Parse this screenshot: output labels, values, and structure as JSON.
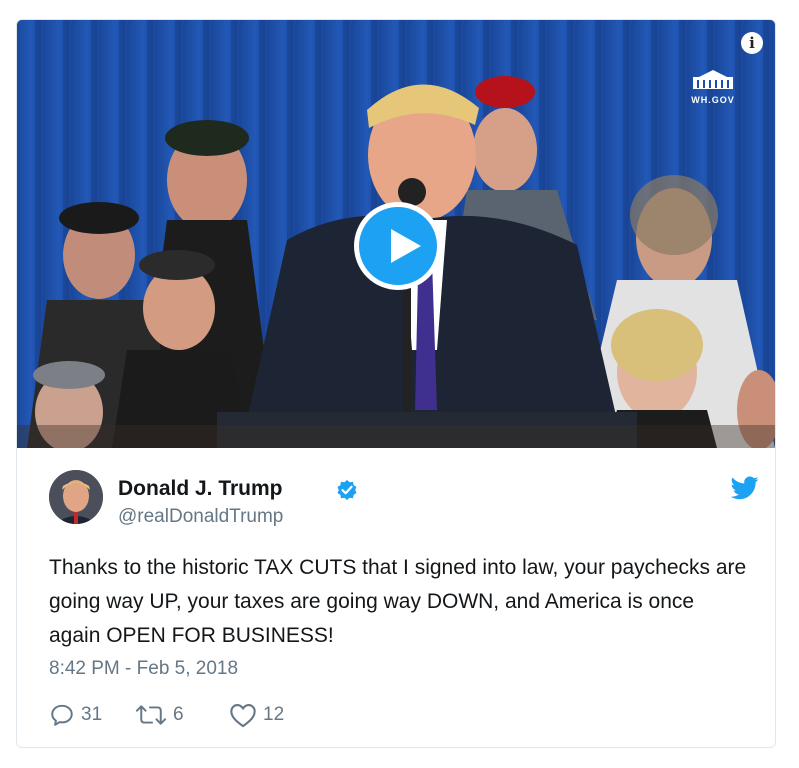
{
  "media": {
    "type": "video",
    "watermark": "WH.GOV",
    "info_icon": "info-icon",
    "play_icon": "play-icon"
  },
  "author": {
    "name": "Donald J. Trump",
    "handle": "@realDonaldTrump",
    "verified": true,
    "avatar_icon": "avatar"
  },
  "tweet": {
    "text": "Thanks to the historic TAX CUTS that I signed into law, your paychecks are going way UP, your taxes are going way DOWN, and America is once again OPEN FOR BUSINESS!",
    "timestamp": "8:42 PM - Feb 5, 2018"
  },
  "actions": {
    "replies": "31",
    "retweets": "6",
    "likes": "12"
  },
  "colors": {
    "accent": "#1da1f2",
    "muted": "#657786",
    "text": "#14171a"
  }
}
